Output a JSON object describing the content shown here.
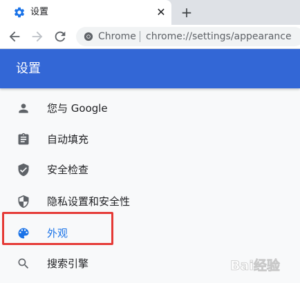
{
  "tab": {
    "title": "设置",
    "close_glyph": "✕",
    "new_tab_glyph": "+"
  },
  "omnibox": {
    "chip": "Chrome",
    "url": "chrome://settings/appearance"
  },
  "header": {
    "title": "设置"
  },
  "sidebar": {
    "items": [
      {
        "label": "您与 Google",
        "icon": "person-icon",
        "selected": false
      },
      {
        "label": "自动填充",
        "icon": "clipboard-icon",
        "selected": false
      },
      {
        "label": "安全检查",
        "icon": "shield-check-icon",
        "selected": false
      },
      {
        "label": "隐私设置和安全性",
        "icon": "shield-half-icon",
        "selected": false
      },
      {
        "label": "外观",
        "icon": "palette-icon",
        "selected": true
      },
      {
        "label": "搜索引擎",
        "icon": "search-icon",
        "selected": false
      }
    ]
  },
  "watermark": {
    "text": "Bai经验"
  },
  "colors": {
    "header": "#3367d6",
    "selected": "#1a73e8",
    "highlight": "#e53935",
    "icon": "#5f6368"
  }
}
